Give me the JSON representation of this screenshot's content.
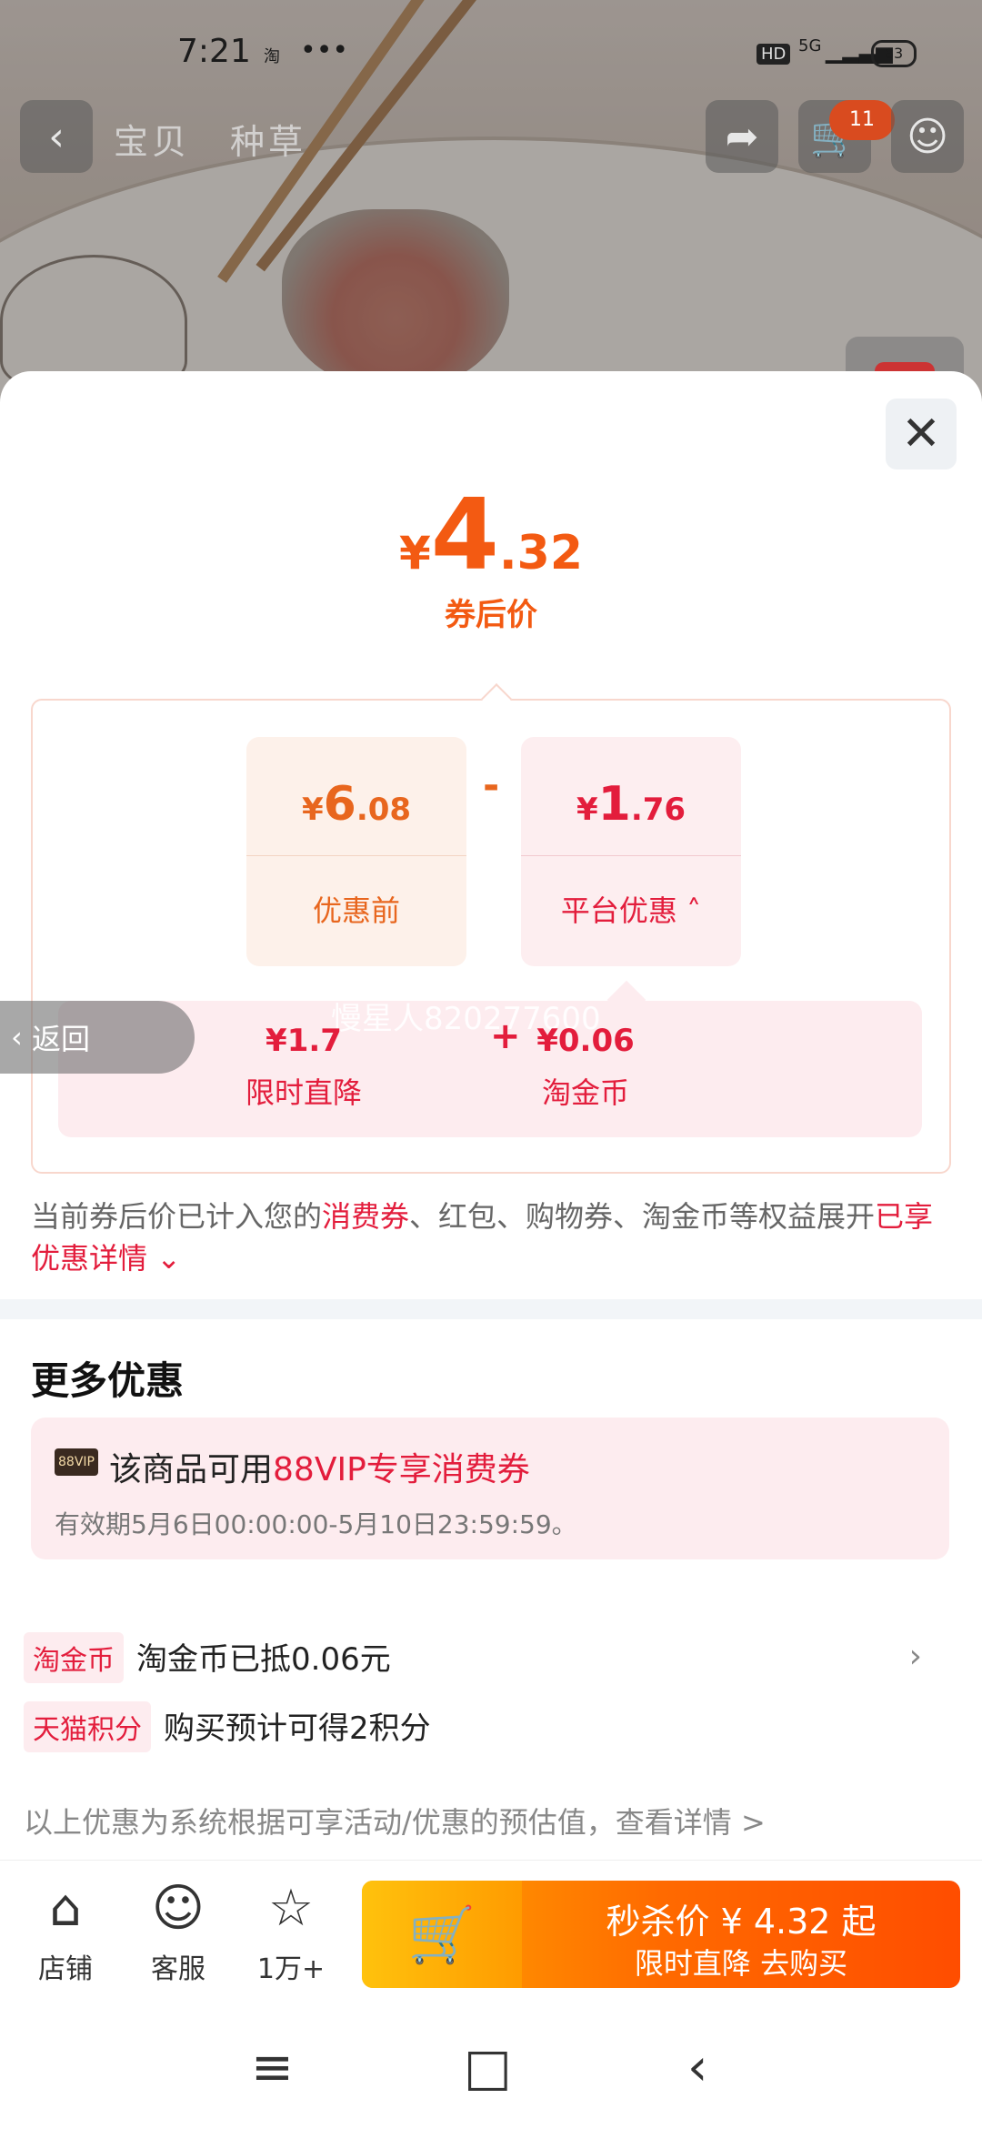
{
  "status_bar": {
    "time": "7:21",
    "taobao_icon": "淘",
    "dots": "•••",
    "hd": "HD",
    "network": "5G",
    "battery": "83"
  },
  "nav": {
    "tab_item": "宝贝",
    "tab_grass": "种草",
    "cart_count": "11"
  },
  "sheet": {
    "price": {
      "currency": "¥",
      "integer": "4",
      "decimal": ".32",
      "label": "券后价"
    },
    "original": {
      "currency": "¥",
      "integer": "6",
      "decimal": ".08",
      "label": "优惠前"
    },
    "minus": "-",
    "platform_discount": {
      "currency": "¥",
      "integer": "1",
      "decimal": ".76",
      "label": "平台优惠"
    },
    "breakdown": {
      "watermark": "慢星人820277600",
      "item1": {
        "value": "¥1.7",
        "label": "限时直降"
      },
      "plus": "+",
      "item2": {
        "value": "¥0.06",
        "label": "淘金币"
      }
    },
    "note": {
      "p1": "当前券后价已计入您的",
      "coupon": "消费券",
      "p2": "、红包、购物券、淘金币等权益展开",
      "details": "已享优惠详情"
    },
    "more_title": "更多优惠",
    "back_label": "返回",
    "vip": {
      "badge": "88VIP",
      "text_prefix": "该商品可用",
      "text_highlight": "88VIP专享消费券",
      "validity": "有效期5月6日00:00:00-5月10日23:59:59。"
    },
    "coin_row": {
      "tag": "淘金币",
      "text": "淘金币已抵0.06元"
    },
    "points_row": {
      "tag": "天猫积分",
      "text": "购买预计可得2积分"
    },
    "footnote": "以上优惠为系统根据可享活动/优惠的预估值，查看详情 >"
  },
  "bottom_bar": {
    "shop": "店铺",
    "service": "客服",
    "favorite_count": "1万+",
    "buy_line1": "秒杀价 ¥ 4.32 起",
    "buy_line2": "限时直降  去购买"
  },
  "colors": {
    "orange": "#f35a12",
    "red": "#e31d3c",
    "pink_bg": "#fdecef"
  }
}
